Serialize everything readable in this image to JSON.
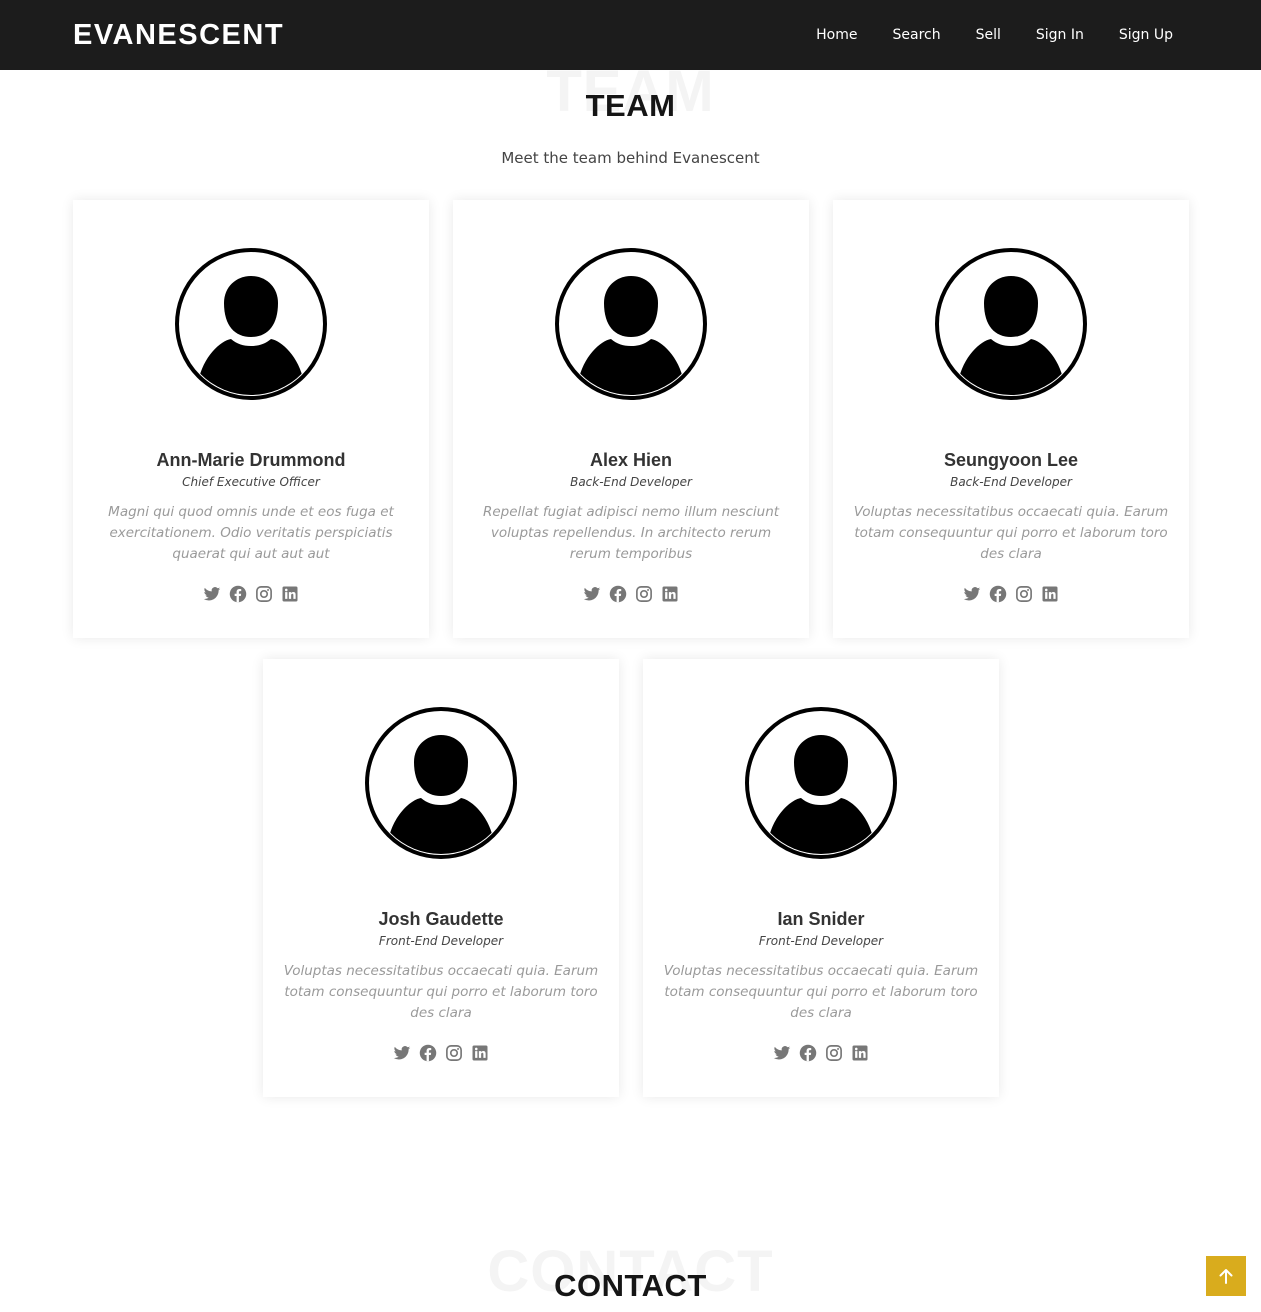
{
  "header": {
    "logo": "EVANESCENT",
    "nav": [
      "Home",
      "Search",
      "Sell",
      "Sign In",
      "Sign Up"
    ]
  },
  "team": {
    "bg_title": "TEAM",
    "title": "TEAM",
    "subtitle": "Meet the team behind Evanescent",
    "members": [
      {
        "name": "Ann-Marie Drummond",
        "role": "Chief Executive Officer",
        "bio": "Magni qui quod omnis unde et eos fuga et exercitationem. Odio veritatis perspiciatis quaerat qui aut aut aut"
      },
      {
        "name": "Alex Hien",
        "role": "Back-End Developer",
        "bio": "Repellat fugiat adipisci nemo illum nesciunt voluptas repellendus. In architecto rerum rerum temporibus"
      },
      {
        "name": "Seungyoon Lee",
        "role": "Back-End Developer",
        "bio": "Voluptas necessitatibus occaecati quia. Earum totam consequuntur qui porro et laborum toro des clara"
      },
      {
        "name": "Josh Gaudette",
        "role": "Front-End Developer",
        "bio": "Voluptas necessitatibus occaecati quia. Earum totam consequuntur qui porro et laborum toro des clara"
      },
      {
        "name": "Ian Snider",
        "role": "Front-End Developer",
        "bio": "Voluptas necessitatibus occaecati quia. Earum totam consequuntur qui porro et laborum toro des clara"
      }
    ],
    "social_icons": [
      "twitter-icon",
      "facebook-icon",
      "instagram-icon",
      "linkedin-icon"
    ]
  },
  "contact": {
    "bg_title": "CONTACT",
    "title": "CONTACT"
  },
  "colors": {
    "header_bg": "#1c1c1c",
    "accent": "#d9ac1d",
    "social_icon": "#777777"
  },
  "back_to_top_icon": "arrow-up-icon"
}
